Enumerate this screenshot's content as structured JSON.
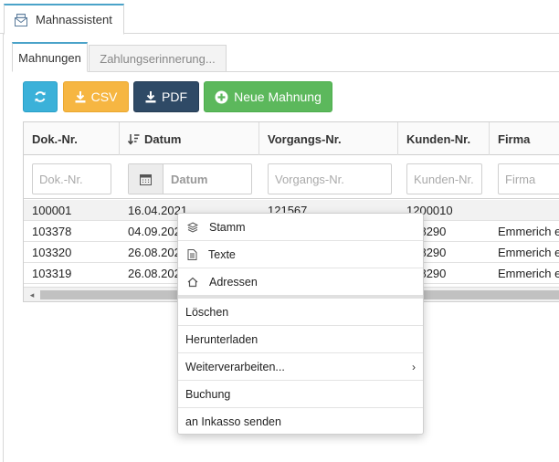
{
  "app": {
    "title": "Mahnassistent"
  },
  "tabs": [
    {
      "label": "Mahnungen",
      "active": true
    },
    {
      "label": "Zahlungserinnerung...",
      "active": false
    }
  ],
  "toolbar": {
    "refresh_icon": "refresh-icon",
    "csv_label": "CSV",
    "pdf_label": "PDF",
    "new_label": "Neue Mahnung",
    "colors": {
      "refresh": "#3bb1d9",
      "csv": "#f6b642",
      "pdf": "#2f4a66",
      "new": "#5cb85c"
    }
  },
  "grid": {
    "columns": [
      "Dok.-Nr.",
      "Datum",
      "Vorgangs-Nr.",
      "Kunden-Nr.",
      "Firma"
    ],
    "filters": {
      "dok_placeholder": "Dok.-Nr.",
      "datum_placeholder": "Datum",
      "vorgang_placeholder": "Vorgangs-Nr.",
      "kunden_placeholder": "Kunden-Nr.",
      "firma_placeholder": "Firma"
    },
    "rows": [
      {
        "dok": "100001",
        "datum": "16.04.2021",
        "vorgang": "121567",
        "kunden": "1200010",
        "firma": ""
      },
      {
        "dok": "103378",
        "datum": "04.09.2021",
        "vorgang": "",
        "kunden": "128290",
        "firma": "Emmerich e"
      },
      {
        "dok": "103320",
        "datum": "26.08.2021",
        "vorgang": "",
        "kunden": "128290",
        "firma": "Emmerich e"
      },
      {
        "dok": "103319",
        "datum": "26.08.2021",
        "vorgang": "",
        "kunden": "128290",
        "firma": "Emmerich e"
      }
    ]
  },
  "context_menu": {
    "icon_items": [
      {
        "label": "Stamm",
        "icon": "layers-icon"
      },
      {
        "label": "Texte",
        "icon": "document-icon"
      },
      {
        "label": "Adressen",
        "icon": "home-icon"
      }
    ],
    "items": [
      {
        "label": "Löschen"
      },
      {
        "label": "Herunterladen"
      },
      {
        "label": "Weiterverarbeiten...",
        "submenu": true
      },
      {
        "label": "Buchung"
      },
      {
        "label": "an Inkasso senden"
      }
    ]
  }
}
